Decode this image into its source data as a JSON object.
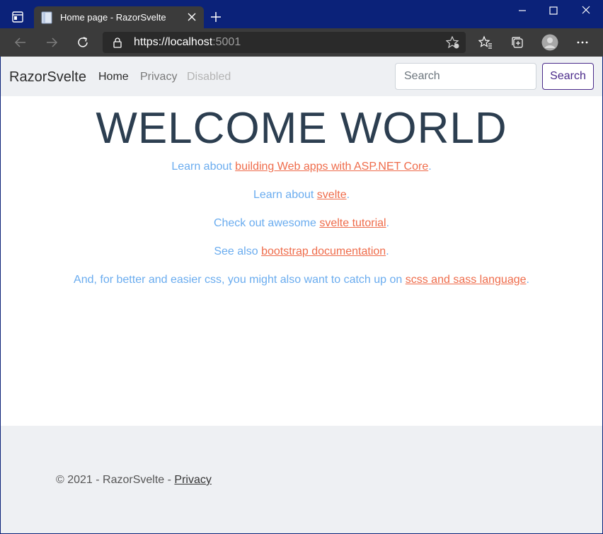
{
  "browser": {
    "tab_title": "Home page - RazorSvelte",
    "url_main": "https://localhost",
    "url_port": ":5001"
  },
  "nav": {
    "brand": "RazorSvelte",
    "links": [
      "Home",
      "Privacy",
      "Disabled"
    ],
    "search_placeholder": "Search",
    "search_button": "Search"
  },
  "main": {
    "heading": "WELCOME WORLD",
    "lines": [
      {
        "before": "Learn about ",
        "link": "building Web apps with ASP.NET Core",
        "after": "."
      },
      {
        "before": "Learn about ",
        "link": "svelte",
        "after": "."
      },
      {
        "before": "Check out awesome ",
        "link": "svelte tutorial",
        "after": "."
      },
      {
        "before": "See also ",
        "link": "bootstrap documentation",
        "after": "."
      },
      {
        "before": "And, for better and easier css, you might also want to catch up on ",
        "link": "scss and sass language",
        "after": "."
      }
    ]
  },
  "footer": {
    "text": "© 2021 - RazorSvelte - ",
    "link": "Privacy"
  },
  "colors": {
    "titlebar": "#0b2279",
    "toolbar": "#3b3b3b",
    "navbar": "#eef0f3",
    "text_blue": "#6aacef",
    "link_orange": "#ef6c4b",
    "heading": "#2c3e50",
    "search_btn": "#4a2a8a"
  },
  "icons": [
    "window-menu-icon",
    "page-favicon-icon",
    "close-tab-icon",
    "new-tab-icon",
    "minimize-icon",
    "maximize-icon",
    "close-window-icon",
    "back-icon",
    "forward-icon",
    "refresh-icon",
    "lock-icon",
    "add-favorite-icon",
    "favorites-icon",
    "collections-icon",
    "profile-icon",
    "more-icon"
  ]
}
